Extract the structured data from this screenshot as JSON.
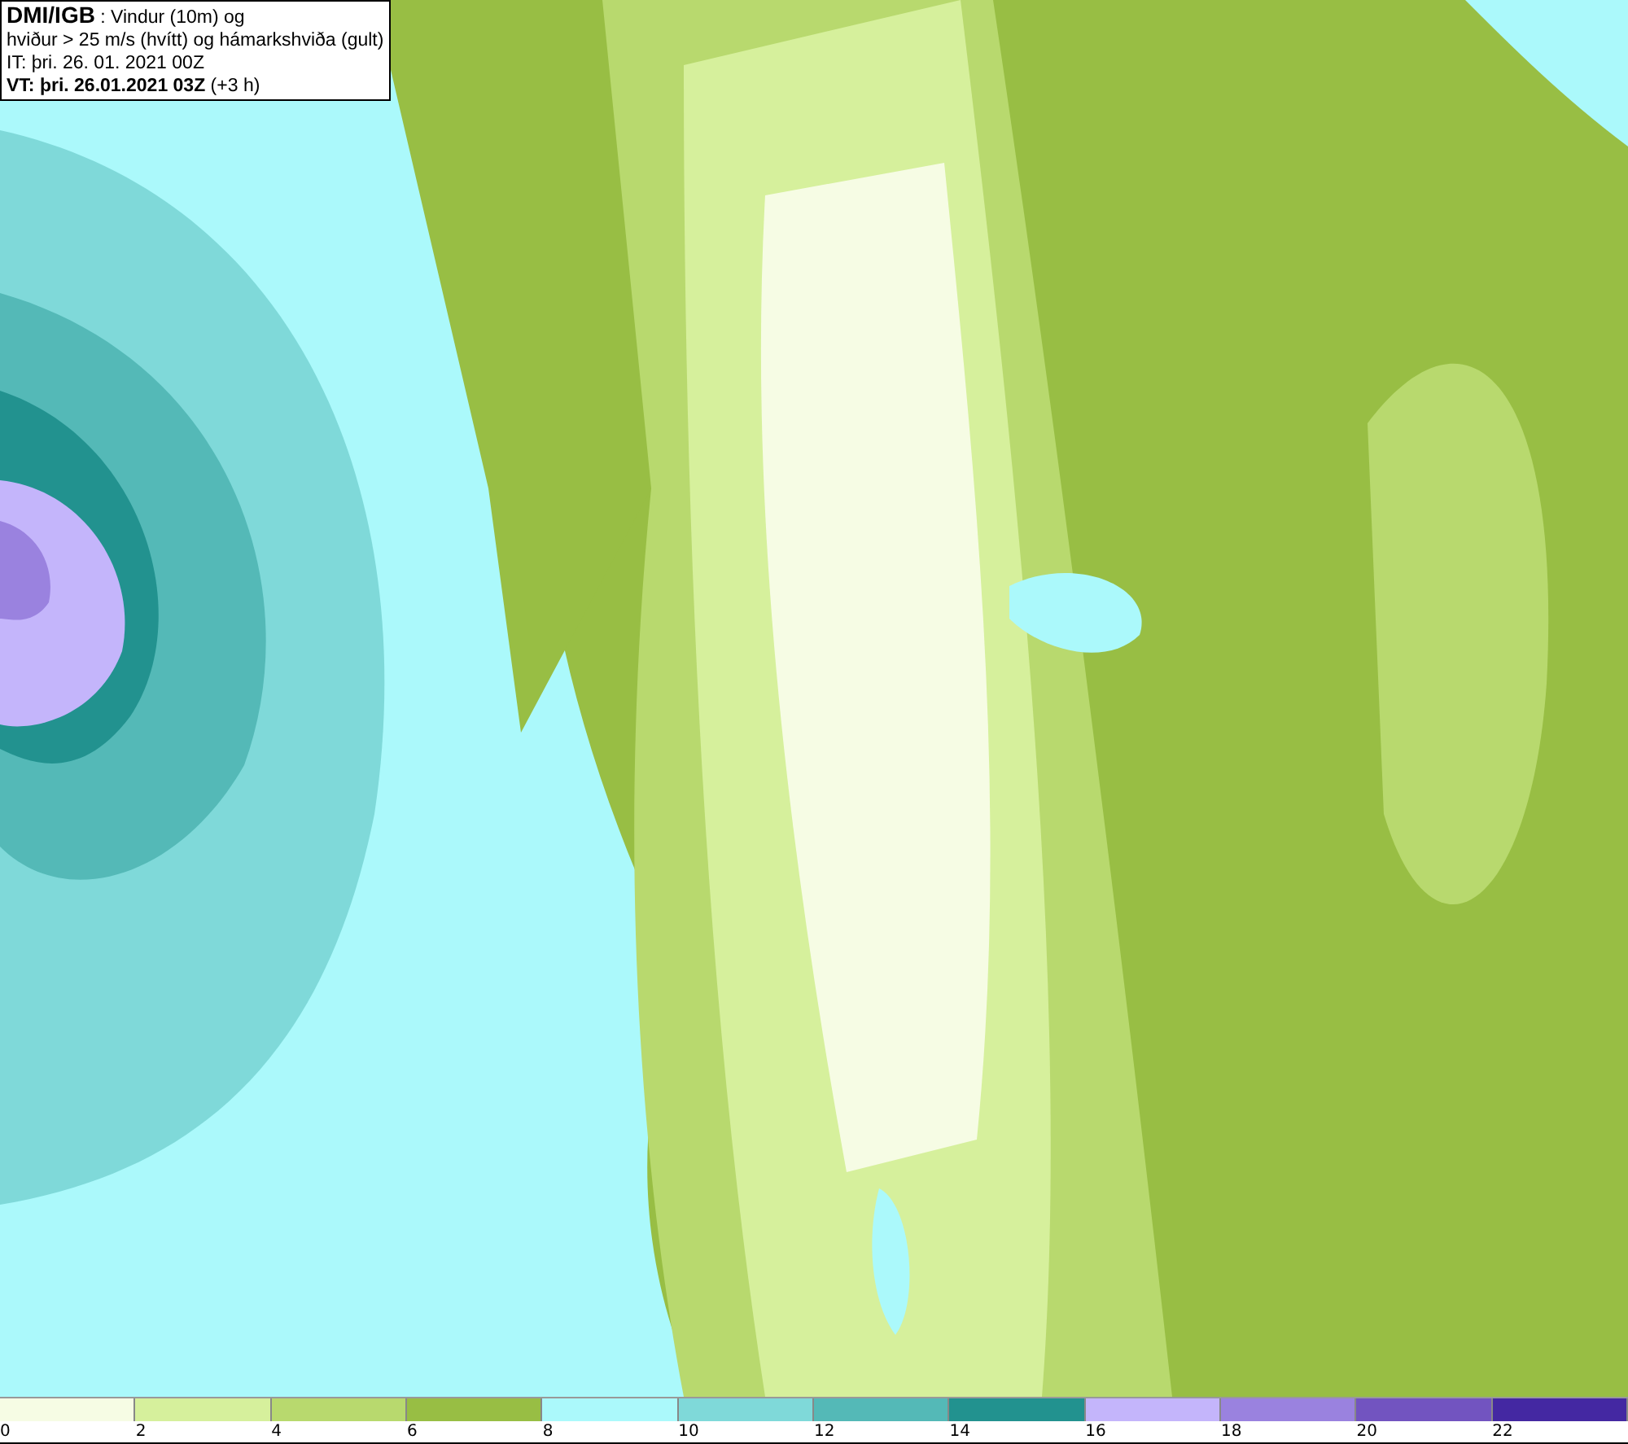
{
  "info_box": {
    "lines": [
      "**DMI/IGB** : Vindur (10m) og",
      "hviður > 25 m/s (hvítt) og hámarkshviða (gult)",
      "IT: þri. 26. 01. 2021 00Z",
      "**VT: þri. 26.01.2021 03Z** (+3 h)"
    ]
  },
  "legend": {
    "bands": [
      {
        "color": "#f6fce4",
        "label": "0"
      },
      {
        "color": "#d6f09c",
        "label": "2"
      },
      {
        "color": "#b8d96e",
        "label": "4"
      },
      {
        "color": "#98be44",
        "label": "6"
      },
      {
        "color": "#abf9fb",
        "label": "8"
      },
      {
        "color": "#7fd9d9",
        "label": "10"
      },
      {
        "color": "#54b9b7",
        "label": "12"
      },
      {
        "color": "#22928f",
        "label": "14"
      },
      {
        "color": "#c4b5fb",
        "label": "16"
      },
      {
        "color": "#9a82df",
        "label": "18"
      },
      {
        "color": "#7254c0",
        "label": "20"
      },
      {
        "color": "#4428a2",
        "label": "22"
      }
    ]
  }
}
